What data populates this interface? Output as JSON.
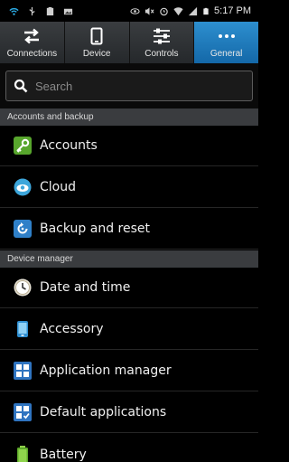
{
  "status_bar": {
    "time": "5:17 PM"
  },
  "tabs": [
    {
      "label": "Connections",
      "icon": "arrows-swap-icon",
      "active": false
    },
    {
      "label": "Device",
      "icon": "phone-icon",
      "active": false
    },
    {
      "label": "Controls",
      "icon": "sliders-icon",
      "active": false
    },
    {
      "label": "General",
      "icon": "more-dots-icon",
      "active": true
    }
  ],
  "search": {
    "placeholder": "Search"
  },
  "sections": {
    "accounts_backup": "Accounts and backup",
    "device_manager": "Device manager"
  },
  "items": {
    "accounts": "Accounts",
    "cloud": "Cloud",
    "backup_reset": "Backup and reset",
    "date_time": "Date and time",
    "accessory": "Accessory",
    "app_manager": "Application manager",
    "default_apps": "Default applications",
    "battery": "Battery"
  },
  "colors": {
    "accent": "#1e7fc0",
    "section_bg": "#3a3c3f"
  }
}
